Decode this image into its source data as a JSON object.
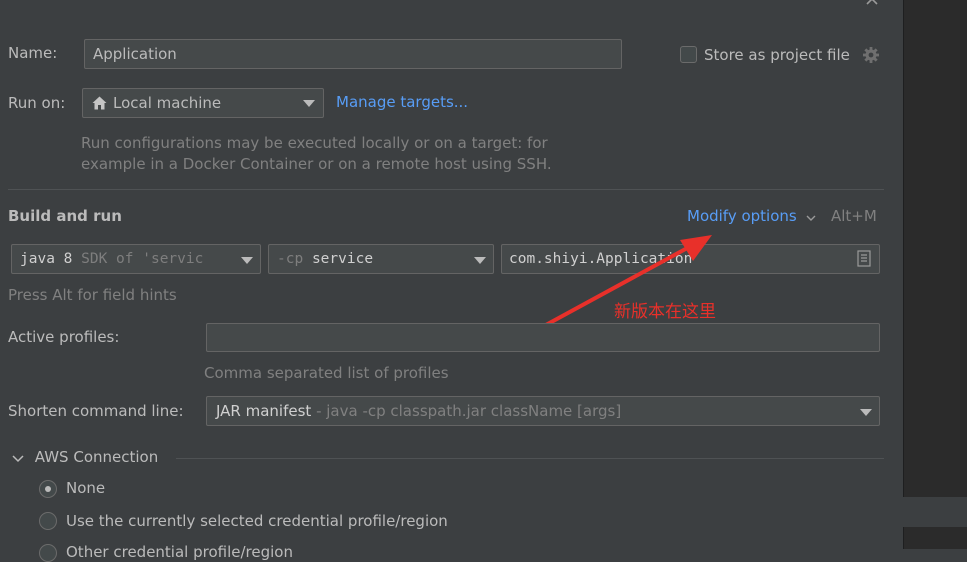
{
  "name": {
    "label": "Name:",
    "value": "Application"
  },
  "store": {
    "label": "Store as project file",
    "checked": false
  },
  "run_on": {
    "label": "Run on:",
    "target": "Local machine",
    "manage_link": "Manage targets...",
    "hint_line1": "Run configurations may be executed locally or on a target: for",
    "hint_line2": "example in a Docker Container or on a remote host using SSH."
  },
  "build": {
    "section_title": "Build and run",
    "modify_options": "Modify options",
    "shortcut": "Alt+M",
    "sdk_primary": "java 8",
    "sdk_secondary": "SDK of 'servic",
    "cp_prefix": "-cp",
    "cp_value": "service",
    "main_class": "com.shiyi.Application",
    "field_hint": "Press Alt for field hints"
  },
  "annotation": {
    "text": "新版本在这里",
    "color": "#e8302a"
  },
  "profiles": {
    "label": "Active profiles:",
    "value": "",
    "hint": "Comma separated list of profiles"
  },
  "shorten": {
    "label": "Shorten command line:",
    "value_main": "JAR manifest",
    "value_detail": " - java -cp classpath.jar className [args]"
  },
  "aws": {
    "section_title": "AWS Connection",
    "options": [
      {
        "label": "None",
        "selected": true
      },
      {
        "label": "Use the currently selected credential profile/region",
        "selected": false
      },
      {
        "label": "Other credential profile/region",
        "selected": false
      }
    ]
  },
  "colors": {
    "link": "#589df6",
    "background": "#3c3f41",
    "field": "#45494a"
  }
}
